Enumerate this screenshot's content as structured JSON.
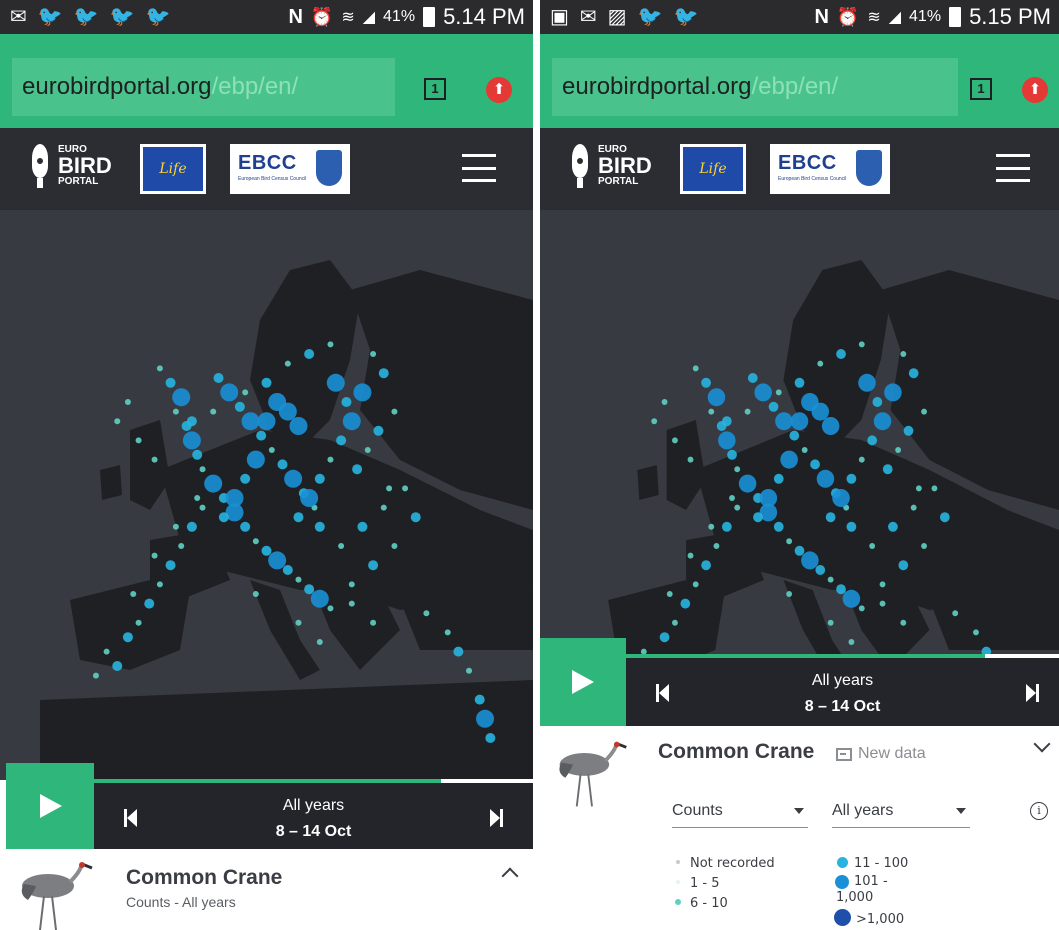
{
  "browser": {
    "url_domain": "eurobirdportal.org",
    "url_path": "/ebp/en/",
    "tab_count": "1"
  },
  "screens": [
    {
      "status": {
        "battery": "41%",
        "time": "5.14 PM",
        "notification_icons": [
          "mail-icon",
          "twitter-icon",
          "twitter-icon",
          "twitter-icon",
          "twitter-icon"
        ]
      },
      "timeline": {
        "period": "All years",
        "dates": "8 – 14 Oct",
        "progress": 0.79
      },
      "species": {
        "name": "Common Crane",
        "subtitle": "Counts - All years"
      }
    },
    {
      "status": {
        "battery": "41%",
        "time": "5.15 PM",
        "notification_icons": [
          "app-icon",
          "mail-icon",
          "gallery-icon",
          "twitter-icon",
          "twitter-icon"
        ]
      },
      "timeline": {
        "period": "All years",
        "dates": "8 – 14 Oct",
        "progress": 0.83
      },
      "species": {
        "name": "Common Crane",
        "new_data_label": "New data"
      },
      "filters": {
        "variable": "Counts",
        "period": "All years"
      },
      "legend": [
        {
          "label": "Not recorded",
          "color": "#c7c9cc"
        },
        {
          "label": "1 - 5",
          "color": "#e4f3f7"
        },
        {
          "label": "6 - 10",
          "color": "#5fd0c4"
        },
        {
          "label": "11 - 100",
          "color": "#27b5e0"
        },
        {
          "label": "101 - 1,000",
          "color": "#1a90d6"
        },
        {
          "label": ">1,000",
          "color": "#1f4fa8"
        }
      ]
    }
  ],
  "colors": {
    "accent": "#2fb67a",
    "header_bg": "#2b2d33",
    "map_sea": "#383a41",
    "map_land": "#1f2024"
  },
  "map_points": [
    [
      0.3,
      0.33,
      1
    ],
    [
      0.32,
      0.36,
      2
    ],
    [
      0.34,
      0.39,
      3
    ],
    [
      0.33,
      0.42,
      1
    ],
    [
      0.35,
      0.45,
      2
    ],
    [
      0.36,
      0.48,
      3
    ],
    [
      0.37,
      0.51,
      2
    ],
    [
      0.38,
      0.54,
      1
    ],
    [
      0.4,
      0.57,
      3
    ],
    [
      0.42,
      0.6,
      2
    ],
    [
      0.44,
      0.63,
      3
    ],
    [
      0.46,
      0.66,
      2
    ],
    [
      0.48,
      0.69,
      1
    ],
    [
      0.5,
      0.71,
      2
    ],
    [
      0.52,
      0.73,
      3
    ],
    [
      0.54,
      0.75,
      2
    ],
    [
      0.56,
      0.77,
      1
    ],
    [
      0.58,
      0.79,
      2
    ],
    [
      0.6,
      0.81,
      3
    ],
    [
      0.62,
      0.83,
      1
    ],
    [
      0.41,
      0.35,
      2
    ],
    [
      0.43,
      0.38,
      3
    ],
    [
      0.45,
      0.41,
      2
    ],
    [
      0.47,
      0.44,
      3
    ],
    [
      0.49,
      0.47,
      2
    ],
    [
      0.51,
      0.5,
      1
    ],
    [
      0.53,
      0.53,
      2
    ],
    [
      0.55,
      0.56,
      3
    ],
    [
      0.57,
      0.59,
      2
    ],
    [
      0.59,
      0.62,
      1
    ],
    [
      0.63,
      0.36,
      3
    ],
    [
      0.65,
      0.4,
      2
    ],
    [
      0.66,
      0.44,
      3
    ],
    [
      0.64,
      0.48,
      2
    ],
    [
      0.62,
      0.52,
      1
    ],
    [
      0.6,
      0.56,
      2
    ],
    [
      0.58,
      0.6,
      3
    ],
    [
      0.56,
      0.64,
      2
    ],
    [
      0.7,
      0.3,
      1
    ],
    [
      0.72,
      0.34,
      2
    ],
    [
      0.68,
      0.38,
      3
    ],
    [
      0.74,
      0.42,
      1
    ],
    [
      0.71,
      0.46,
      2
    ],
    [
      0.69,
      0.5,
      1
    ],
    [
      0.67,
      0.54,
      2
    ],
    [
      0.73,
      0.58,
      1
    ],
    [
      0.52,
      0.4,
      3
    ],
    [
      0.54,
      0.42,
      3
    ],
    [
      0.56,
      0.45,
      3
    ],
    [
      0.5,
      0.44,
      3
    ],
    [
      0.48,
      0.52,
      3
    ],
    [
      0.46,
      0.56,
      2
    ],
    [
      0.44,
      0.6,
      3
    ],
    [
      0.42,
      0.64,
      2
    ],
    [
      0.38,
      0.62,
      1
    ],
    [
      0.36,
      0.66,
      2
    ],
    [
      0.34,
      0.7,
      1
    ],
    [
      0.32,
      0.74,
      2
    ],
    [
      0.3,
      0.78,
      1
    ],
    [
      0.28,
      0.82,
      2
    ],
    [
      0.26,
      0.86,
      1
    ],
    [
      0.24,
      0.89,
      2
    ],
    [
      0.2,
      0.92,
      1
    ],
    [
      0.22,
      0.95,
      2
    ],
    [
      0.18,
      0.97,
      1
    ],
    [
      0.25,
      0.8,
      1
    ],
    [
      0.29,
      0.72,
      1
    ],
    [
      0.33,
      0.66,
      1
    ],
    [
      0.37,
      0.6,
      1
    ],
    [
      0.6,
      0.66,
      2
    ],
    [
      0.64,
      0.7,
      1
    ],
    [
      0.68,
      0.66,
      2
    ],
    [
      0.72,
      0.62,
      1
    ],
    [
      0.76,
      0.58,
      1
    ],
    [
      0.78,
      0.64,
      2
    ],
    [
      0.74,
      0.7,
      1
    ],
    [
      0.7,
      0.74,
      2
    ],
    [
      0.66,
      0.78,
      1
    ],
    [
      0.8,
      0.84,
      1
    ],
    [
      0.84,
      0.88,
      1
    ],
    [
      0.86,
      0.92,
      2
    ],
    [
      0.88,
      0.96,
      1
    ],
    [
      0.9,
      1.02,
      2
    ],
    [
      0.91,
      1.06,
      3
    ],
    [
      0.92,
      1.1,
      2
    ],
    [
      0.54,
      0.32,
      1
    ],
    [
      0.58,
      0.3,
      2
    ],
    [
      0.62,
      0.28,
      1
    ],
    [
      0.5,
      0.36,
      2
    ],
    [
      0.46,
      0.38,
      1
    ],
    [
      0.4,
      0.42,
      1
    ],
    [
      0.36,
      0.44,
      2
    ],
    [
      0.24,
      0.4,
      1
    ],
    [
      0.22,
      0.44,
      1
    ],
    [
      0.26,
      0.48,
      1
    ],
    [
      0.29,
      0.52,
      1
    ],
    [
      0.66,
      0.82,
      1
    ],
    [
      0.7,
      0.86,
      1
    ],
    [
      0.56,
      0.86,
      1
    ],
    [
      0.6,
      0.9,
      1
    ],
    [
      0.48,
      0.8,
      1
    ]
  ]
}
